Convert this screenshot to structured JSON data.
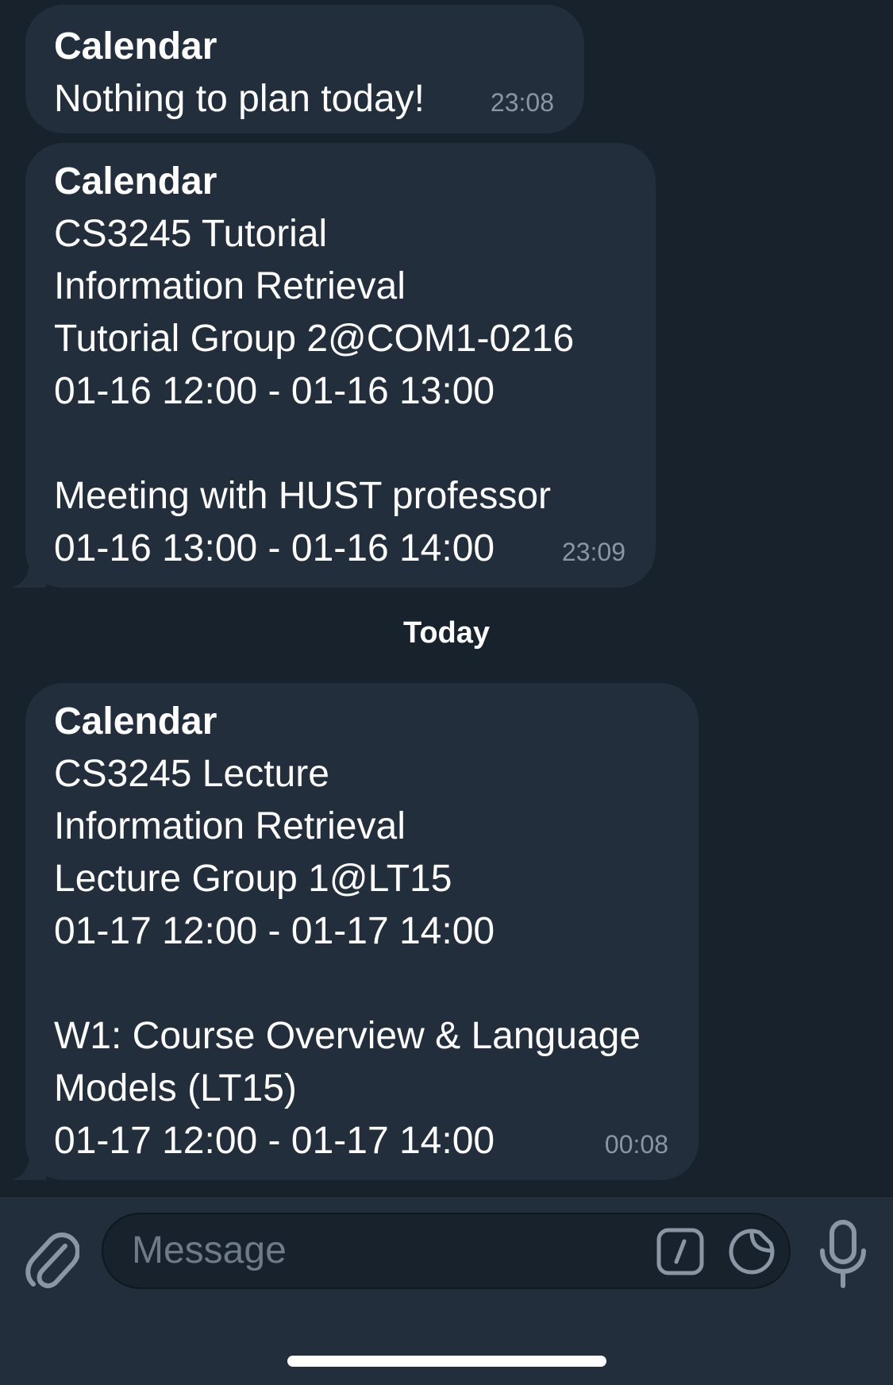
{
  "messages": [
    {
      "sender": "Calendar",
      "lines": [
        "Nothing to plan today!"
      ],
      "time": "23:08"
    },
    {
      "sender": "Calendar",
      "lines": [
        "CS3245 Tutorial",
        "Information Retrieval",
        "Tutorial Group 2@COM1-0216",
        "01-16 12:00 - 01-16 13:00",
        "",
        "Meeting with HUST professor",
        "01-16 13:00 - 01-16 14:00"
      ],
      "time": "23:09"
    },
    {
      "sender": "Calendar",
      "lines": [
        "CS3245 Lecture",
        "Information Retrieval",
        "Lecture Group 1@LT15",
        "01-17 12:00 - 01-17 14:00",
        "",
        "W1: Course Overview & Language",
        "Models (LT15)",
        "01-17 12:00 - 01-17 14:00"
      ],
      "time": "00:08"
    }
  ],
  "date_separator": "Today",
  "composer": {
    "placeholder": "Message",
    "icons": [
      "paperclip-icon",
      "bot-command-icon",
      "sticker-icon",
      "microphone-icon"
    ]
  },
  "colors": {
    "background": "#18222d",
    "bubble": "#232e3c",
    "time_text": "#8a96a3",
    "placeholder_text": "#6e7a86",
    "icon": "#8a96a3"
  }
}
